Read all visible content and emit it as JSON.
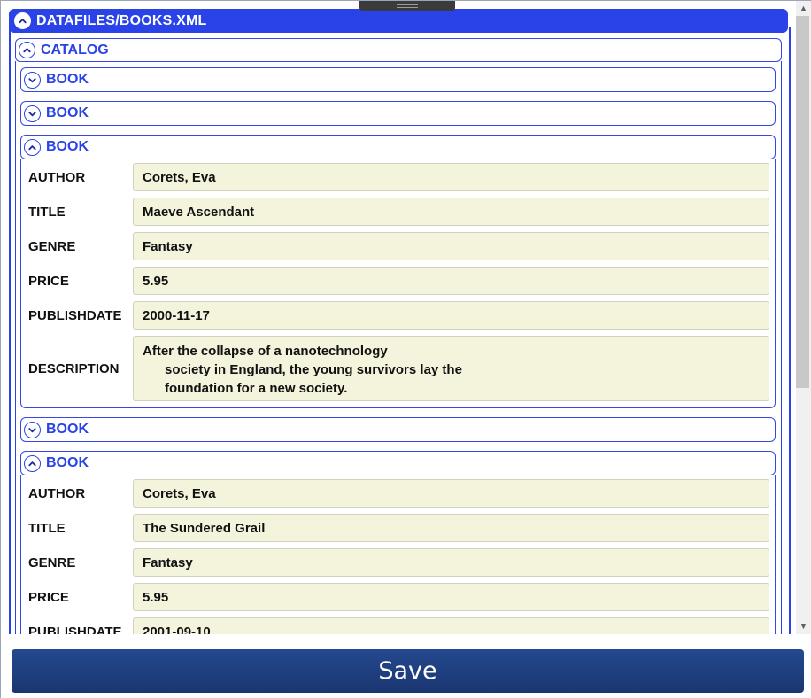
{
  "root": {
    "title": "DATAFILES/BOOKS.XML"
  },
  "catalog": {
    "title": "CATALOG"
  },
  "icons": {
    "expanded": "chevron-up-icon",
    "collapsed": "chevron-down-icon"
  },
  "colors": {
    "accent": "#2a43e8",
    "field_bg": "#f4f3dc",
    "save_bg": "#1f3e7a"
  },
  "books": [
    {
      "title": "BOOK",
      "expanded": false
    },
    {
      "title": "BOOK",
      "expanded": false
    },
    {
      "title": "BOOK",
      "expanded": true,
      "fields": [
        {
          "label": "AUTHOR",
          "value": "Corets, Eva"
        },
        {
          "label": "TITLE",
          "value": "Maeve Ascendant"
        },
        {
          "label": "GENRE",
          "value": "Fantasy"
        },
        {
          "label": "PRICE",
          "value": "5.95"
        },
        {
          "label": "PUBLISHDATE",
          "value": "2000-11-17"
        },
        {
          "label": "DESCRIPTION",
          "value": "After the collapse of a nanotechnology\n      society in England, the young survivors lay the\n      foundation for a new society."
        }
      ]
    },
    {
      "title": "BOOK",
      "expanded": false
    },
    {
      "title": "BOOK",
      "expanded": true,
      "fields": [
        {
          "label": "AUTHOR",
          "value": "Corets, Eva"
        },
        {
          "label": "TITLE",
          "value": "The Sundered Grail"
        },
        {
          "label": "GENRE",
          "value": "Fantasy"
        },
        {
          "label": "PRICE",
          "value": "5.95"
        },
        {
          "label": "PUBLISHDATE",
          "value": "2001-09-10"
        }
      ]
    }
  ],
  "save": {
    "label": "Save"
  }
}
